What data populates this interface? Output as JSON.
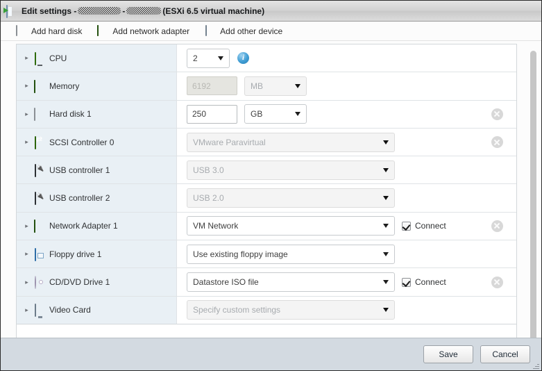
{
  "window": {
    "title_prefix": "Edit settings -",
    "title_suffix": "(ESXi 6.5 virtual machine)",
    "redacted_blocks": 2,
    "title_icon": "vm-settings-icon"
  },
  "toolbar": {
    "items": [
      {
        "label": "Add hard disk",
        "icon": "hard-disk-icon"
      },
      {
        "label": "Add network adapter",
        "icon": "network-adapter-icon"
      },
      {
        "label": "Add other device",
        "icon": "other-device-icon"
      }
    ]
  },
  "devices": [
    {
      "name": "CPU",
      "icon": "cpu-icon",
      "expandable": true,
      "control": "select-info",
      "value": "2",
      "disabled": false,
      "info": "i",
      "removable": false
    },
    {
      "name": "Memory",
      "icon": "memory-icon",
      "expandable": true,
      "control": "text-unit",
      "value": "6192",
      "unit": "MB",
      "disabled": true,
      "removable": false
    },
    {
      "name": "Hard disk 1",
      "icon": "hard-disk-icon",
      "expandable": true,
      "control": "text-unit",
      "value": "250",
      "unit": "GB",
      "disabled": false,
      "removable": true
    },
    {
      "name": "SCSI Controller 0",
      "icon": "scsi-controller-icon",
      "expandable": true,
      "control": "select-wide",
      "value": "VMware Paravirtual",
      "disabled": true,
      "removable": true
    },
    {
      "name": "USB controller 1",
      "icon": "usb-controller-icon",
      "expandable": false,
      "control": "select-wide",
      "value": "USB 3.0",
      "disabled": true,
      "removable": false
    },
    {
      "name": "USB controller 2",
      "icon": "usb-controller-icon",
      "expandable": false,
      "control": "select-wide",
      "value": "USB 2.0",
      "disabled": true,
      "removable": false
    },
    {
      "name": "Network Adapter 1",
      "icon": "network-adapter-icon",
      "expandable": true,
      "control": "select-wide",
      "value": "VM Network",
      "disabled": false,
      "connect_label": "Connect",
      "connect_checked": true,
      "removable": true
    },
    {
      "name": "Floppy drive 1",
      "icon": "floppy-drive-icon",
      "expandable": true,
      "control": "select-wide",
      "value": "Use existing floppy image",
      "disabled": false,
      "removable": false
    },
    {
      "name": "CD/DVD Drive 1",
      "icon": "cd-dvd-icon",
      "expandable": true,
      "control": "select-wide",
      "value": "Datastore ISO file",
      "disabled": false,
      "connect_label": "Connect",
      "connect_checked": true,
      "removable": true
    },
    {
      "name": "Video Card",
      "icon": "video-card-icon",
      "expandable": true,
      "control": "select-wide",
      "value": "Specify custom settings",
      "disabled": true,
      "removable": false
    }
  ],
  "footer": {
    "save_label": "Save",
    "cancel_label": "Cancel"
  },
  "colors": {
    "title_bar": "#d2d2d2",
    "name_column": "#e9f0f5",
    "footer": "#d3dae1",
    "accent_green": "#7bc043",
    "info_blue": "#3f9dd4",
    "scrollbar_thumb": "#c6c6c6"
  }
}
